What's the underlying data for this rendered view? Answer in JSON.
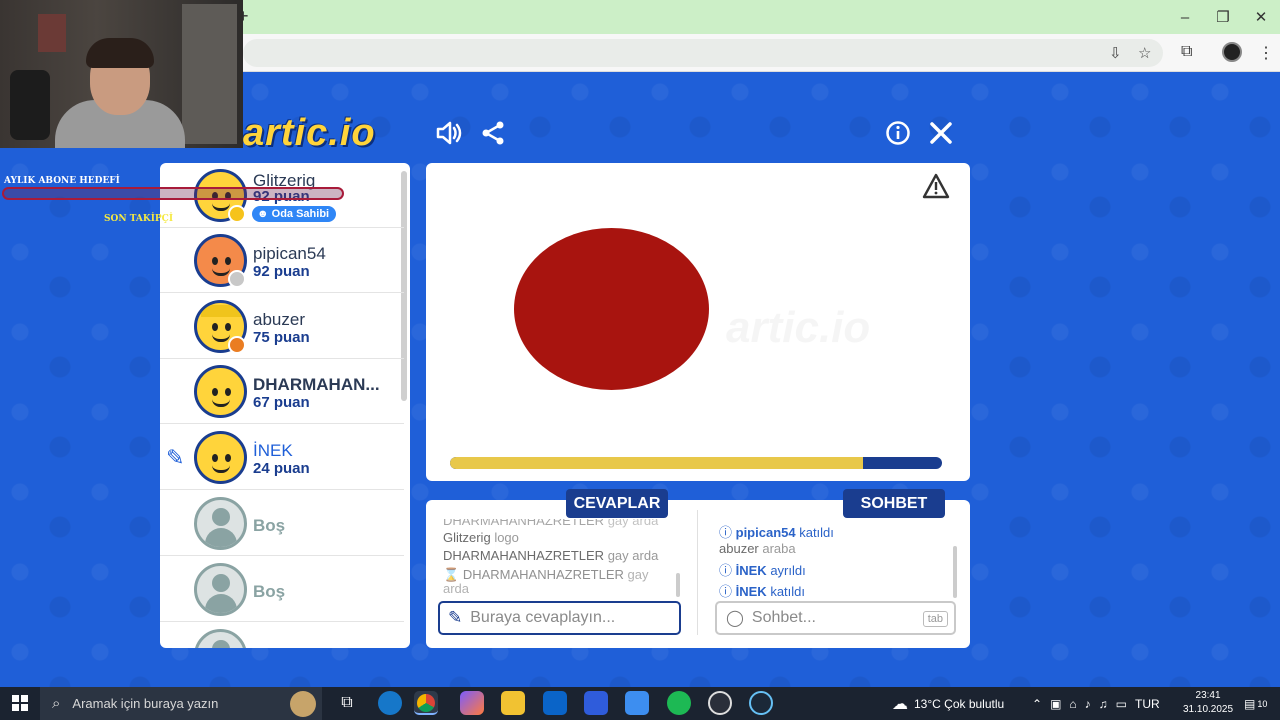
{
  "browser": {
    "new_tab": "+",
    "window_controls": [
      "–",
      "❐",
      "✕"
    ]
  },
  "overlay": {
    "monthly_goal": "AYLIK ABONE HEDEFİ",
    "last_follower": "SON TAKİPÇİ"
  },
  "game": {
    "logo": "artic.io",
    "top_icons": [
      "sound-icon",
      "share-icon",
      "info-icon",
      "close-icon"
    ],
    "players": [
      {
        "name": "Glitzerig",
        "score": "92 puan",
        "badge": "Oda Sahibi",
        "avatar_color": "#ffd43b",
        "dot": "#f6c31b"
      },
      {
        "name": "pipican54",
        "score": "92 puan",
        "avatar_color": "#f48a4a",
        "dot": "#c8c8c8"
      },
      {
        "name": "abuzer",
        "score": "75 puan",
        "avatar_color": "#ffd43b",
        "dot": "#ea7d22"
      },
      {
        "name": "DHARMAHAN...",
        "score": "67 puan",
        "avatar_color": "#ffd43b"
      },
      {
        "name": "İNEK",
        "score": "24 puan",
        "avatar_color": "#ffd43b",
        "drawing": true
      }
    ],
    "empty_slot_label": "Boş",
    "timer_fraction": 0.84,
    "answers_tab": "CEVAPLAR",
    "chat_tab": "SOHBET",
    "answers": [
      {
        "user": "DHARMAHANHAZRETLER",
        "text": "gay arda"
      },
      {
        "user": "Glitzerig",
        "text": "logo"
      },
      {
        "user": "DHARMAHANHAZRETLER",
        "text": "gay arda"
      },
      {
        "user": "DHARMAHANHAZRETLER",
        "text": "gay arda"
      }
    ],
    "chat": [
      {
        "user": "pipican54",
        "text": "katıldı"
      },
      {
        "user": "abuzer",
        "text": "araba"
      },
      {
        "user": "İNEK",
        "text": "ayrıldı"
      },
      {
        "user": "İNEK",
        "text": "katıldı"
      }
    ],
    "answer_placeholder": "Buraya cevaplayın...",
    "chat_placeholder": "Sohbet...",
    "tab_key": "tab"
  },
  "taskbar": {
    "search_text": "Aramak için buraya yazın",
    "weather": "13°C  Çok bulutlu",
    "lang": "TUR",
    "time": "23:41",
    "date": "31.10.2025",
    "notif_count": "10"
  }
}
